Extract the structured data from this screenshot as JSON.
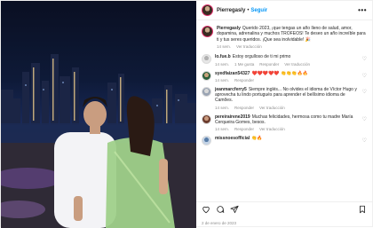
{
  "header": {
    "username": "Pierregasly",
    "separator": "•",
    "follow_label": "Seguir",
    "more_label": "•••"
  },
  "caption": {
    "username": "Pierregasly",
    "text": "Querido 2023, ¡que tengas un año lleno de salud, amor, dopamina, adrenalina y muchos TROFEOS! Te deseo un año increíble para ti y tus seres queridos. ¡Que sea inolvidable! 🎉",
    "time": "14 sem.",
    "translate": "Ver traducción"
  },
  "comments": [
    {
      "username": "lo.fue.b",
      "text": "Estoy orgulloso de ti mi primo",
      "meta": [
        "14 sem.",
        "1 Me gusta",
        "Responder",
        "Ver traducción"
      ]
    },
    {
      "username": "syedfaizan54327",
      "text": "❤️❤️❤️❤️❤️ 👏👏👏🔥🔥",
      "meta": [
        "14 sem.",
        "Responder"
      ]
    },
    {
      "username": "jeanmarcferry5",
      "text": "Siempre inglés... No olvides el idioma de Víctor Hugo y aprovecha tu lindo portugués para aprender el bellísimo idioma de Camões.",
      "meta": [
        "14 sem.",
        "Responder",
        "Ver traducción"
      ]
    },
    {
      "username": "pereirairene2019",
      "text": "Muchas felicidades, hermosa como tu madre María Cerqueira Gomes, besos.",
      "meta": [
        "14 sem.",
        "Responder",
        "Ver traducción"
      ]
    },
    {
      "username": "missnoesofficial",
      "text": "👏🔥",
      "meta": []
    }
  ],
  "footer": {
    "date": "2 de enero de 2023"
  },
  "icons": [
    "heart-icon",
    "comment-icon",
    "share-icon",
    "bookmark-icon",
    "more-icon"
  ],
  "colors": {
    "follow": "#0095f6",
    "muted": "#8e8e8e"
  }
}
